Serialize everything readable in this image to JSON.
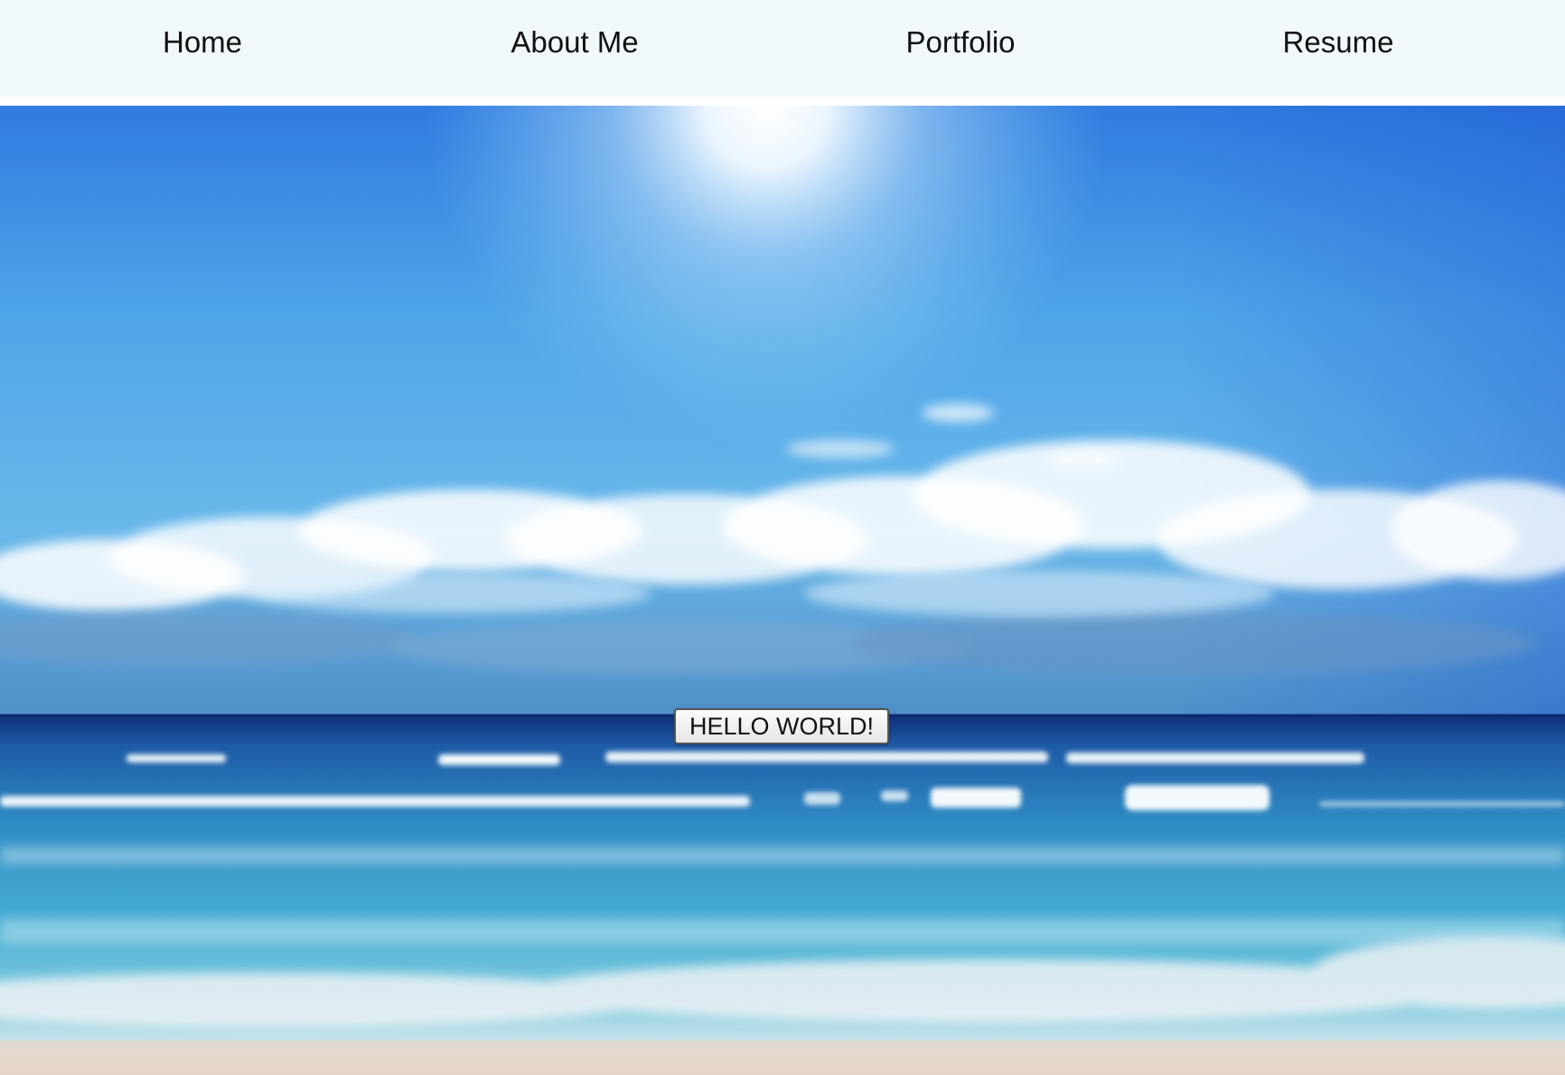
{
  "nav": {
    "items": [
      {
        "label": "Home"
      },
      {
        "label": "About Me"
      },
      {
        "label": "Portfolio"
      },
      {
        "label": "Resume"
      }
    ]
  },
  "hero": {
    "background": "beach-ocean-sky-photo",
    "button_label": "HELLO WORLD!"
  },
  "colors": {
    "nav_bg": "#f0f8fb",
    "sky_top": "#2f6fd6",
    "sky_mid": "#5ab2ea",
    "sea_dark": "#123b86",
    "sea_light": "#4fb3d6",
    "sand": "#e6d6c6"
  }
}
